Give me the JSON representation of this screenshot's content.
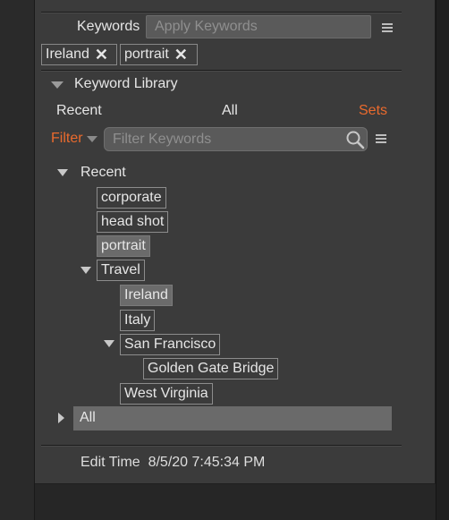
{
  "keywords": {
    "label": "Keywords",
    "input_placeholder": "Apply Keywords",
    "applied": [
      {
        "label": "Ireland",
        "remove_icon": "close-icon"
      },
      {
        "label": "portrait",
        "remove_icon": "close-icon"
      }
    ]
  },
  "library": {
    "title": "Keyword Library",
    "tabs": [
      "Recent",
      "All",
      "Sets"
    ],
    "active_tab": "Sets",
    "filter_label": "Filter",
    "filter_placeholder": "Filter Keywords",
    "tree": {
      "recent_label": "Recent",
      "recent_items": [
        "corporate",
        "head shot",
        "portrait"
      ],
      "travel_label": "Travel",
      "travel_items": [
        "Ireland",
        "Italy"
      ],
      "san_francisco_label": "San Francisco",
      "san_francisco_items": [
        "Golden Gate Bridge"
      ],
      "west_virginia_label": "West Virginia",
      "all_label": "All"
    }
  },
  "footer": {
    "edit_time_label": "Edit Time",
    "edit_time_value": "8/5/20 7:45:34 PM"
  },
  "colors": {
    "accent": "#ea6a2d",
    "panel": "#3b3b3b",
    "selected": "#6b6b6b"
  }
}
